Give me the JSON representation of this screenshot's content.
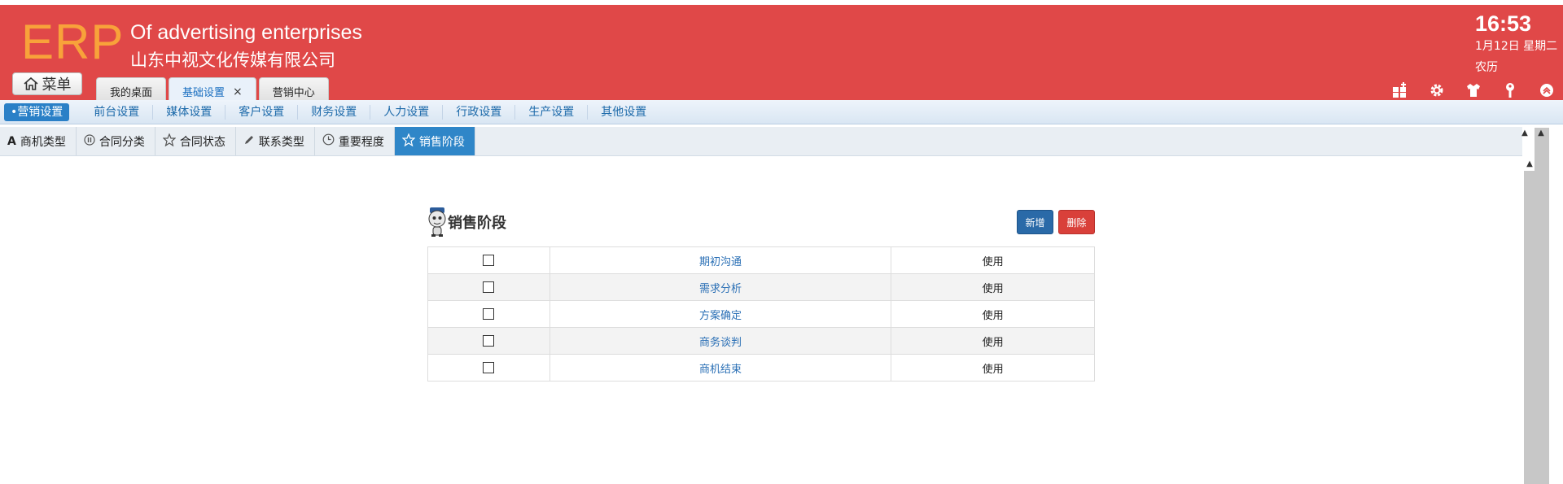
{
  "app": {
    "logo": "ERP",
    "company_en": "Of advertising enterprises",
    "company_cn": "山东中视文化传媒有限公司"
  },
  "header": {
    "menu_label": "菜单",
    "tabs": [
      {
        "label": "我的桌面"
      },
      {
        "label": "基础设置",
        "close": "×"
      },
      {
        "label": "营销中心"
      }
    ],
    "clock": "16:53",
    "date": "1月12日 星期二",
    "lunar": "农历",
    "tool_icons": [
      "grid-add-icon",
      "gear-icon",
      "shirt-icon",
      "key-icon",
      "collapse-up-icon"
    ]
  },
  "settings_nav": {
    "items": [
      "•营销设置",
      "前台设置",
      "媒体设置",
      "客户设置",
      "财务设置",
      "人力设置",
      "行政设置",
      "生产设置",
      "其他设置"
    ]
  },
  "sub_tabs": [
    {
      "icon": "letter-a-icon",
      "label": "商机类型"
    },
    {
      "icon": "pause-circle-icon",
      "label": "合同分类"
    },
    {
      "icon": "star-icon",
      "label": "合同状态"
    },
    {
      "icon": "pencil-icon",
      "label": "联系类型"
    },
    {
      "icon": "clock-icon",
      "label": "重要程度"
    },
    {
      "icon": "star-icon",
      "label": "销售阶段"
    }
  ],
  "panel": {
    "title": "销售阶段",
    "new_label": "新增",
    "delete_label": "删除",
    "rows": [
      {
        "name": "期初沟通",
        "status": "使用"
      },
      {
        "name": "需求分析",
        "status": "使用"
      },
      {
        "name": "方案确定",
        "status": "使用"
      },
      {
        "name": "商务谈判",
        "status": "使用"
      },
      {
        "name": "商机结束",
        "status": "使用"
      }
    ]
  },
  "colors": {
    "header_bg": "#e04848",
    "logo": "#f8a23a",
    "accent_blue": "#2f86c8",
    "delete_red": "#d9403a"
  }
}
